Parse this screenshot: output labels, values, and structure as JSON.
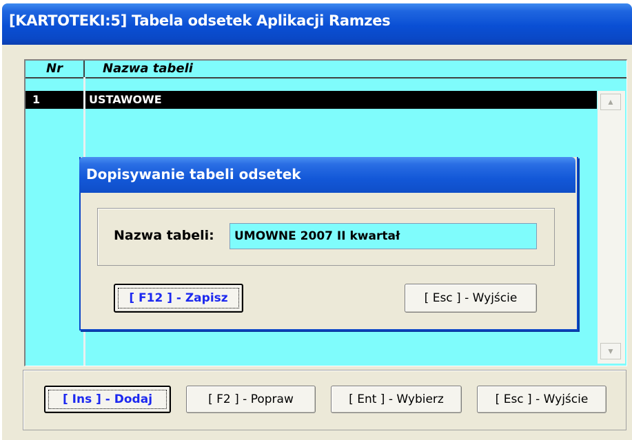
{
  "window": {
    "title": "[KARTOTEKI:5]  Tabela odsetek Aplikacji Ramzes"
  },
  "table": {
    "columns": [
      "Nr",
      "Nazwa tabeli"
    ],
    "rows": [
      {
        "nr": "1",
        "name": "USTAWOWE",
        "selected": true
      }
    ]
  },
  "scrollbar": {
    "up_icon": "scroll-up-arrow",
    "down_icon": "scroll-down-arrow"
  },
  "toolbar": {
    "add_label": "[ Ins ] - Dodaj",
    "edit_label": "[ F2 ] - Popraw",
    "select_label": "[ Ent ] - Wybierz",
    "exit_label": "[ Esc ] - Wyjście"
  },
  "dialog": {
    "title": "Dopisywanie tabeli odsetek",
    "field_label": "Nazwa tabeli:",
    "field_value": "UMOWNE 2007 II kwartał",
    "save_label": "[ F12 ] - Zapisz",
    "exit_label": "[ Esc ] - Wyjście"
  },
  "colors": {
    "grid_background": "#7ffcfc",
    "titlebar": "#0a4fd4",
    "selected_row": "#000000",
    "primary_button_text": "#1c28f0"
  }
}
